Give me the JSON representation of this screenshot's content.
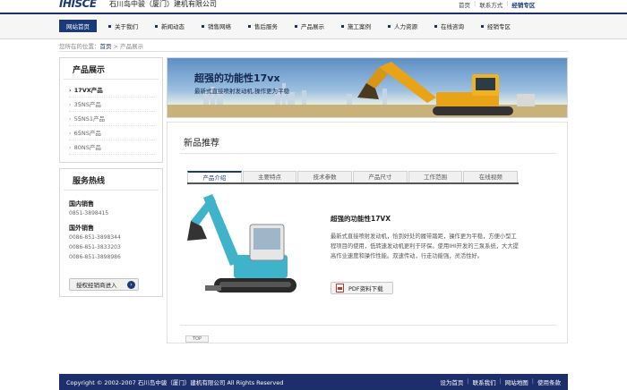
{
  "header": {
    "logo": "IHISCE",
    "company": "石川岛中骏（厦门）建机有限公司",
    "links": [
      "首页",
      "联系方式",
      "经销专区"
    ]
  },
  "nav": {
    "items": [
      "网站首页",
      "关于我们",
      "新闻动态",
      "销售网络",
      "售后服务",
      "产品展示",
      "施工案例",
      "人力资源",
      "在线咨询",
      "经销专区"
    ]
  },
  "breadcrumb": {
    "prefix": "您所在的位置：",
    "home": "首页",
    "sep": " > ",
    "current": "产品展示"
  },
  "sidebar": {
    "products_title": "产品展示",
    "products": [
      "17VX产品",
      "35NS产品",
      "55NS1产品",
      "65NS产品",
      "80NS产品"
    ],
    "hotline_title": "服务热线",
    "domestic_label": "国内销售",
    "domestic_numbers": [
      "0851-3898415"
    ],
    "foreign_label": "国外销售",
    "foreign_numbers": [
      "0086-851-3898344",
      "0086-851-3833203",
      "0086-851-3898986"
    ],
    "dealer_button": "授权经销商进入"
  },
  "banner": {
    "title": "超强的功能性17vx",
    "subtitle": "最新式直接喷射发动机,操作更为平稳"
  },
  "main": {
    "section_title": "新品推荐",
    "tabs": [
      "产品介绍",
      "主要特点",
      "技术参数",
      "产品尺寸",
      "工作范围",
      "在线视频"
    ],
    "product_name": "超强的功能性17VX",
    "product_desc": "最新式直接喷射发动机，恰到好处的履带踏距，操作更为平稳，方便小型工程项目的使用，低转速发动机更利于环保。使用IHI开发的三泵系统，大大提高作业速度和操作性能。双速传动，行走功能强，灵活性好。",
    "pdf_button": "PDF资料下载",
    "top_button": "TOP"
  },
  "footer": {
    "copyright": "Copyright © 2002-2007 石川岛中骏（厦门）建机有限公司 All Rights Reserved",
    "links": [
      "设为首页",
      "联系我们",
      "网站地图",
      "使用条款"
    ]
  },
  "colors": {
    "brand": "#1c3a78",
    "footer": "#1c2f6b",
    "excavator": "#3fb3c9"
  }
}
